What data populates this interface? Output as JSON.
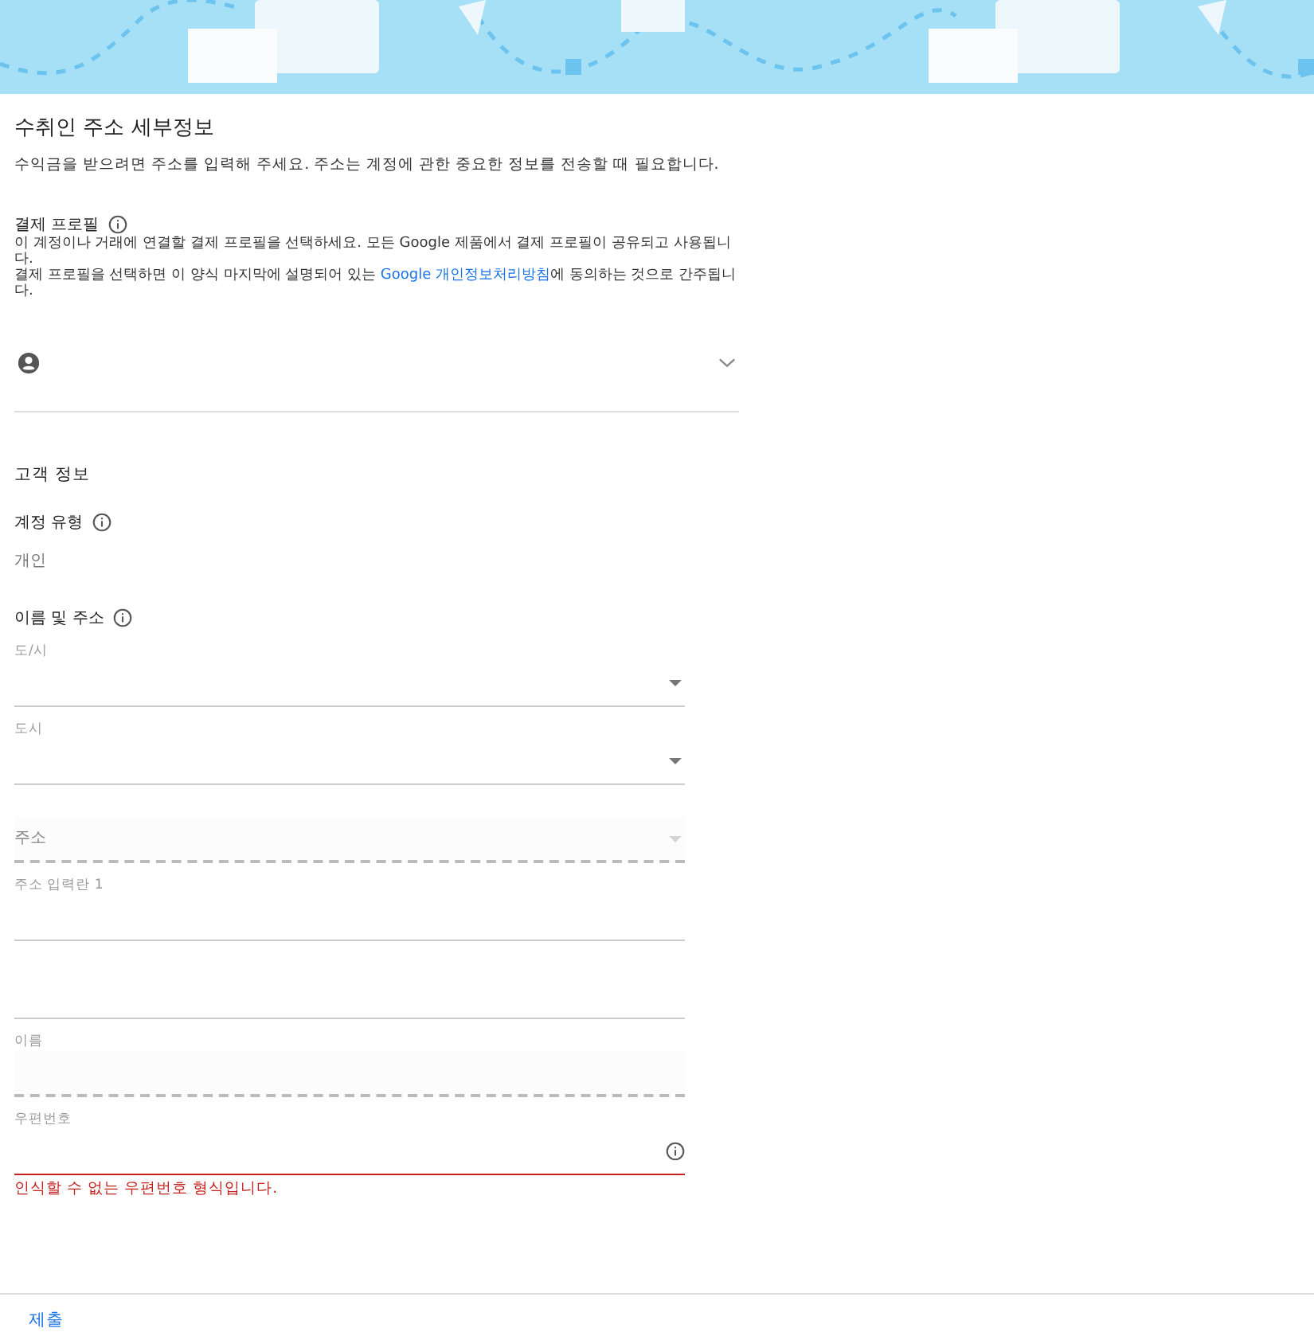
{
  "header": {
    "title": "수취인 주소 세부정보",
    "description": "수익금을 받으려면 주소를 입력해 주세요. 주소는 계정에 관한 중요한 정보를 전송할 때 필요합니다."
  },
  "payment_profile": {
    "label": "결제 프로필",
    "text_1": "이 계정이나 거래에 연결할 결제 프로필을 선택하세요. 모든 Google 제품에서 결제 프로필이 공유되고 사용됩니다.",
    "text_2_before": "결제 프로필을 선택하면 이 양식 마지막에 설명되어 있는 ",
    "link": "Google 개인정보처리방침",
    "text_2_after": "에 동의하는 것으로 간주됩니다.",
    "expanded": false
  },
  "customer_info": {
    "title": "고객 정보",
    "account_type_label": "계정 유형",
    "account_type_value": "개인",
    "name_address_label": "이름 및 주소"
  },
  "fields": [
    {
      "kind": "select",
      "label": "도/시",
      "disabled": false,
      "error": false
    },
    {
      "kind": "select",
      "label": "도시",
      "disabled": false,
      "error": false
    },
    {
      "kind": "select",
      "placeholder": "주소",
      "disabled": true,
      "error": false
    },
    {
      "kind": "text",
      "label": "주소 입력란 1",
      "disabled": false,
      "error": false
    },
    {
      "kind": "text",
      "disabled": false,
      "error": false
    },
    {
      "kind": "text",
      "label": "이름",
      "disabled": true,
      "error": false
    },
    {
      "kind": "text",
      "label": "우편번호",
      "disabled": false,
      "error": true,
      "error_message": "인식할 수 없는 우편번호 형식입니다."
    }
  ],
  "footer": {
    "submit": "제출"
  }
}
